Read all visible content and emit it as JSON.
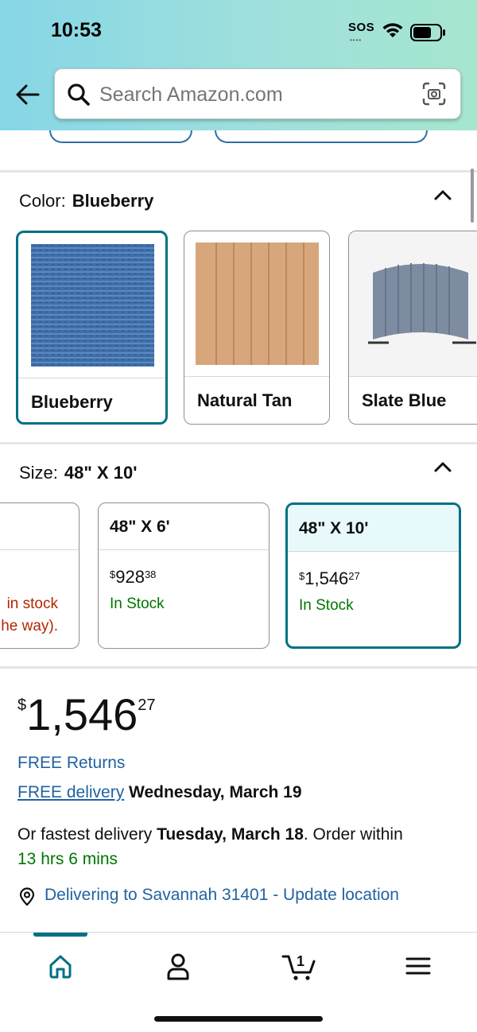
{
  "status_bar": {
    "time": "10:53",
    "sos": "SOS",
    "sos_dots": "••••"
  },
  "search": {
    "placeholder": "Search Amazon.com"
  },
  "color_section": {
    "label": "Color:",
    "selected": "Blueberry",
    "options": [
      {
        "name": "Blueberry",
        "selected": true,
        "swatch_color": "#3e6ea9"
      },
      {
        "name": "Natural Tan",
        "selected": false,
        "swatch_color": "#d7a77c"
      },
      {
        "name": "Slate Blue",
        "selected": false,
        "swatch_color": "#7b8a9c"
      }
    ]
  },
  "size_section": {
    "label": "Size:",
    "selected": "48\" X 10'",
    "partial_card": {
      "line1": "in stock",
      "line2": "he way)."
    },
    "options": [
      {
        "name": "48\" X 6'",
        "price_dollars": "928",
        "price_cents": "38",
        "currency": "$",
        "stock": "In Stock",
        "selected": false
      },
      {
        "name": "48\" X 10'",
        "price_dollars": "1,546",
        "price_cents": "27",
        "currency": "$",
        "stock": "In Stock",
        "selected": true
      }
    ]
  },
  "price": {
    "currency": "$",
    "dollars": "1,546",
    "cents": "27"
  },
  "returns": {
    "label": "FREE Returns"
  },
  "delivery": {
    "link_label": "FREE delivery",
    "date": "Wednesday, March 19",
    "fastest_prefix": "Or fastest delivery",
    "fastest_date": "Tuesday, March 18",
    "order_within_prefix": ". Order within",
    "countdown": "13 hrs 6 mins"
  },
  "location": {
    "label": "Delivering to Savannah 31401 - Update location"
  },
  "nav": {
    "cart_count": "1",
    "items": [
      "home",
      "account",
      "cart",
      "menu"
    ]
  },
  "colors": {
    "accent": "#007185",
    "link": "#2162a1",
    "in_stock": "#007600",
    "warning": "#b12704"
  }
}
